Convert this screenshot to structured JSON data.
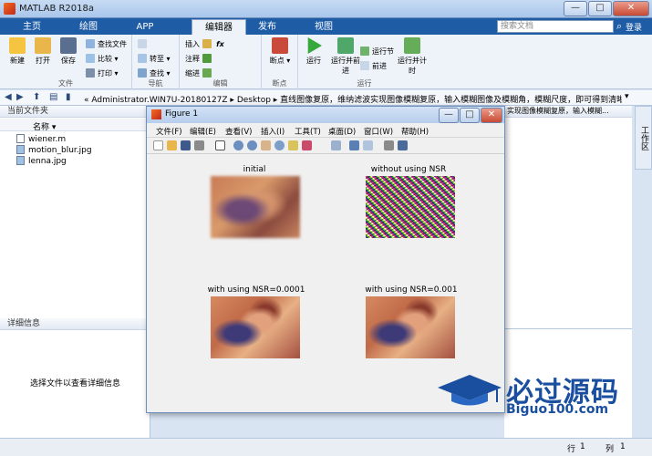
{
  "app": {
    "title": "MATLAB R2018a",
    "window_min": "—",
    "window_max": "□",
    "window_close": "✕"
  },
  "tabs": [
    "主页",
    "绘图",
    "APP",
    "编辑器",
    "发布",
    "视图"
  ],
  "active_tab": "编辑器",
  "search": {
    "placeholder": "搜索文档",
    "login": "登录"
  },
  "ribbon": {
    "file_group": {
      "label": "文件",
      "new": "新建",
      "open": "打开",
      "save": "保存",
      "find_files": "查找文件",
      "compare": "比较",
      "print": "打印"
    },
    "nav_group": {
      "label": "导航",
      "goto": "转至",
      "find": "查找"
    },
    "edit_group": {
      "label": "编辑",
      "insert": "插入",
      "comment": "注释",
      "indent": "缩进",
      "fx": "fx"
    },
    "breakpoints_group": {
      "label": "断点",
      "breakpoints": "断点"
    },
    "run_group": {
      "label": "运行",
      "run": "运行",
      "run_advance": "运行并前进",
      "run_section": "运行节",
      "advance": "前进",
      "run_time": "运行并计时"
    }
  },
  "address": {
    "path": "« Administrator.WIN7U-20180127Z ▸ Desktop ▸ 直线图像复原，维纳滤波实现图像模糊复原，输入模糊图像及模糊角，模糊尺度，即可得到清晰图像"
  },
  "left_panel": {
    "title": "当前文件夹",
    "column": "名称 ▾",
    "files": [
      "wiener.m",
      "motion_blur.jpg",
      "lenna.jpg"
    ],
    "details_title": "详细信息",
    "details_empty": "选择文件以查看详细信息"
  },
  "right_panel": {
    "header": "实现图像模糊复原，输入模糊...",
    "side_tab": "工作区"
  },
  "figure": {
    "title": "Figure 1",
    "menu": [
      "文件(F)",
      "编辑(E)",
      "查看(V)",
      "插入(I)",
      "工具(T)",
      "桌面(D)",
      "窗口(W)",
      "帮助(H)"
    ],
    "subplots": [
      {
        "title": "initial"
      },
      {
        "title": "without using NSR"
      },
      {
        "title": "with using NSR=0.0001"
      },
      {
        "title": "with using NSR=0.001"
      }
    ]
  },
  "status": {
    "row_label": "行",
    "row": "1",
    "col_label": "列",
    "col": "1"
  },
  "watermark": {
    "main": "必过源码",
    "sub": "Biguo100.com"
  },
  "colors": {
    "tabstrip": "#1e5ca6",
    "accent": "#1a4fa0"
  }
}
